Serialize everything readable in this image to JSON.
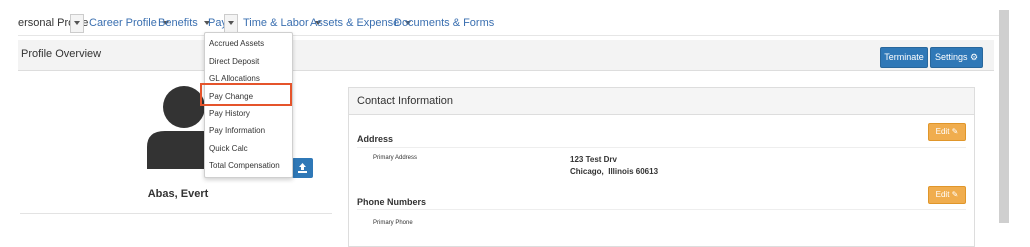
{
  "nav": {
    "items": [
      "ersonal Profile",
      "Career Profile",
      "Benefits",
      "Pay",
      "Time & Labor",
      "Assets & Expense",
      "Documents & Forms"
    ]
  },
  "overview": {
    "title": "Profile Overview",
    "terminate_label": "Terminate",
    "settings_label": "Settings"
  },
  "employee": {
    "name": "Abas, Evert"
  },
  "pay_menu": {
    "items": [
      "Accrued Assets",
      "Direct Deposit",
      "GL Allocations",
      "Pay Change",
      "Pay History",
      "Pay Information",
      "Quick Calc",
      "Total Compensation"
    ],
    "highlighted": "Pay Change"
  },
  "contact": {
    "title": "Contact Information",
    "address_label": "Address",
    "edit_label": "Edit",
    "primary_address_label": "Primary Address",
    "address_line1": "123 Test Drv",
    "address_line2": "Chicago,  Illinois 60613",
    "phone_label": "Phone Numbers",
    "primary_phone_label": "Primary Phone"
  },
  "colors": {
    "primary": "#2f78b7",
    "warning": "#f0ad4e",
    "highlight": "#e5542b"
  }
}
